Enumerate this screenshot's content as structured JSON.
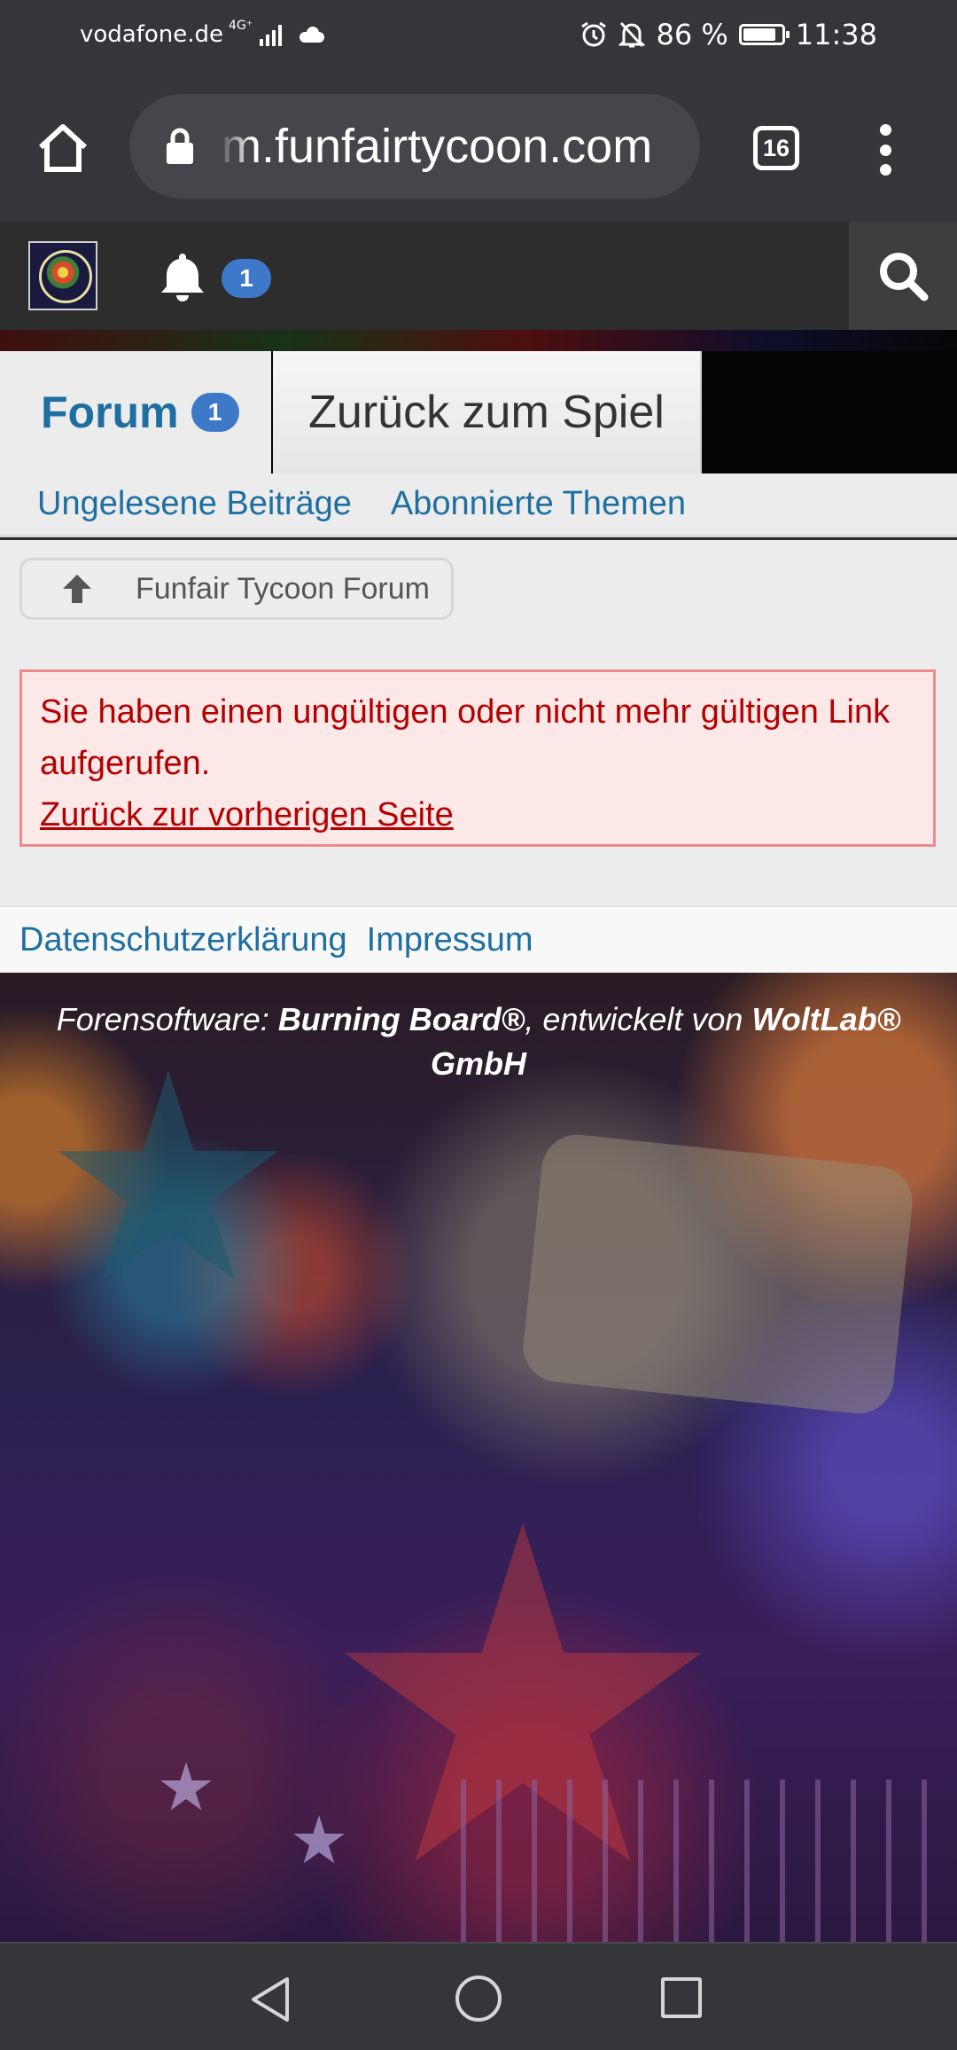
{
  "status_bar": {
    "carrier": "vodafone.de",
    "network": "4G⁺",
    "battery_percent": "86 %",
    "battery_level": 0.86,
    "time": "11:38"
  },
  "browser": {
    "url": "m.funfairtycoon.com",
    "tab_count": "16"
  },
  "header": {
    "notification_count": "1"
  },
  "tabs": [
    {
      "label": "Forum",
      "badge": "1",
      "active": true
    },
    {
      "label": "Zurück zum Spiel",
      "active": false
    }
  ],
  "sub_nav": {
    "unread": "Ungelesene Beiträge",
    "subscribed": "Abonnierte Themen"
  },
  "breadcrumb": {
    "label": "Funfair Tycoon Forum"
  },
  "error": {
    "message": "Sie haben einen ungültigen oder nicht mehr gültigen Link aufgerufen.",
    "back_link": "Zurück zur vorherigen Seite"
  },
  "footer": {
    "privacy": "Datenschutzerklärung",
    "imprint": "Impressum",
    "credit_prefix": "Forensoftware: ",
    "credit_product": "Burning Board®",
    "credit_middle": ", entwickelt von ",
    "credit_company": "WoltLab® GmbH"
  },
  "colors": {
    "link": "#1e6fa0",
    "badge": "#3d79c8",
    "error_text": "#b40000",
    "error_bg": "#fde8e8",
    "error_border": "#ee8c8c"
  },
  "icons": {
    "home": "home-icon",
    "lock": "lock-icon",
    "menu": "more-vert-icon",
    "bell": "bell-icon",
    "search": "search-icon",
    "breadcrumb": "arrow-up-icon",
    "nav_back": "triangle-back-icon",
    "nav_home": "circle-home-icon",
    "nav_recent": "square-recent-icon"
  }
}
